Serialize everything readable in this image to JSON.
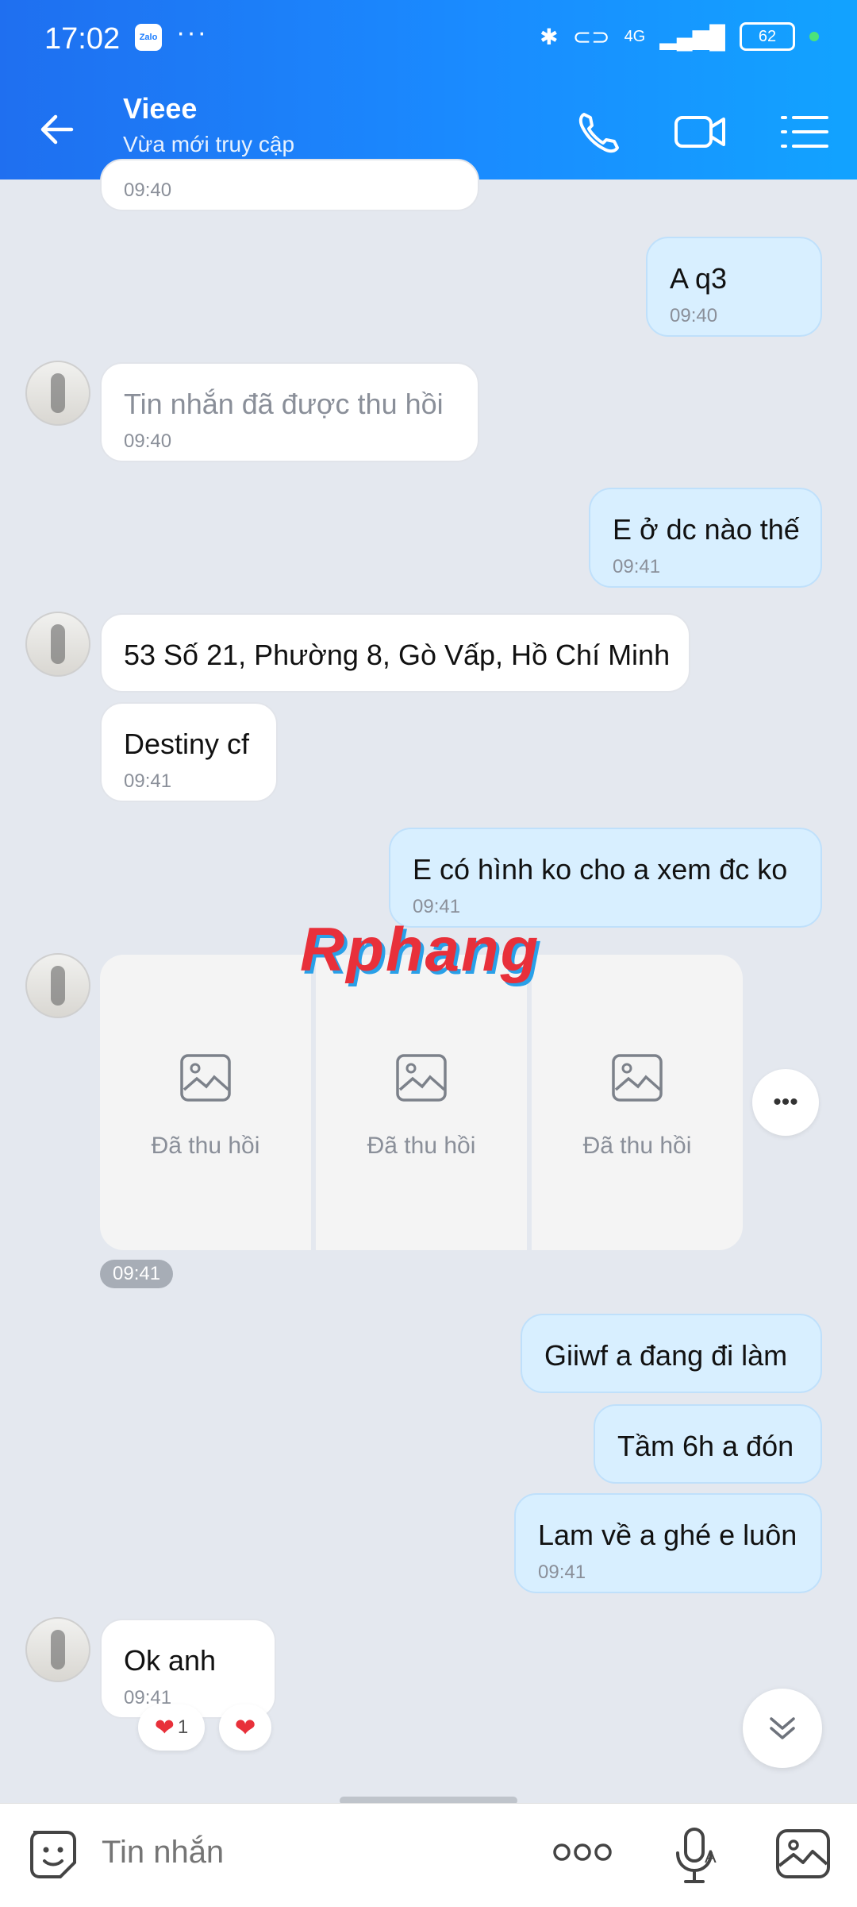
{
  "status_bar": {
    "time": "17:02",
    "app_badge": "Zalo",
    "network": "4G",
    "battery": "62"
  },
  "header": {
    "contact_name": "Vieee",
    "contact_status": "Vừa mới truy cập"
  },
  "messages": [
    {
      "side": "in",
      "text": "",
      "time": "09:40"
    },
    {
      "side": "out",
      "text": "A q3",
      "time": "09:40"
    },
    {
      "side": "in",
      "text": "Tin nhắn đã được thu hồi",
      "time": "09:40",
      "recalled": true
    },
    {
      "side": "out",
      "text": "E ở dc nào thế",
      "time": "09:41"
    },
    {
      "side": "in",
      "text": "53 Số 21, Phường 8, Gò Vấp, Hồ Chí Minh",
      "time": ""
    },
    {
      "side": "in",
      "text": "Destiny cf",
      "time": "09:41"
    },
    {
      "side": "out",
      "text": "E có hình ko cho a xem đc ko",
      "time": "09:41"
    },
    {
      "side": "out",
      "text": "Giiwf a đang đi làm",
      "time": ""
    },
    {
      "side": "out",
      "text": "Tầm 6h a đón",
      "time": ""
    },
    {
      "side": "out",
      "text": "Lam về a ghé e luôn",
      "time": "09:41"
    },
    {
      "side": "in",
      "text": "Ok anh",
      "time": "09:41"
    }
  ],
  "image_group": {
    "items": [
      "Đã thu hồi",
      "Đã thu hồi",
      "Đã thu hồi"
    ],
    "time": "09:41"
  },
  "reactions": {
    "count": "1"
  },
  "watermark": "Rphang",
  "composer": {
    "placeholder": "Tin nhắn"
  },
  "colors": {
    "header": "#1a8bff",
    "outgoing_bubble": "#d8efff",
    "incoming_bubble": "#ffffff",
    "background": "#e4e8ef"
  }
}
